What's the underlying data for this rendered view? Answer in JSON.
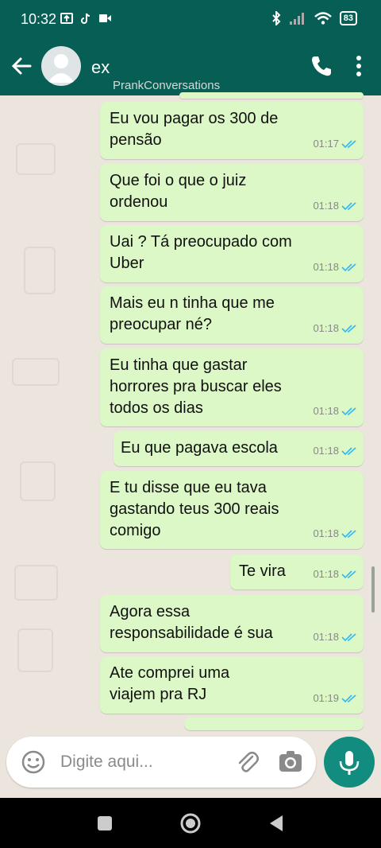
{
  "status_bar": {
    "time": "10:32",
    "battery": "83"
  },
  "header": {
    "contact_name": "ex",
    "watermark": "PrankConversations"
  },
  "messages": [
    {
      "text": "Eu vou pagar os 300 de pensão",
      "time": "01:17"
    },
    {
      "text": "Que foi o que o juiz ordenou",
      "time": "01:18"
    },
    {
      "text": "Uai ? Tá preocupado com Uber",
      "time": "01:18"
    },
    {
      "text": "Mais eu n tinha que me preocupar né?",
      "time": "01:18"
    },
    {
      "text": "Eu tinha que gastar horrores pra buscar eles todos os dias",
      "time": "01:18"
    },
    {
      "text": "Eu que pagava escola",
      "time": "01:18"
    },
    {
      "text": "E tu disse que eu tava gastando teus 300 reais comigo",
      "time": "01:18"
    },
    {
      "text": "Te vira",
      "time": "01:18"
    },
    {
      "text": "Agora essa responsabilidade é sua",
      "time": "01:18"
    },
    {
      "text": "Ate comprei uma viajem pra RJ",
      "time": "01:19"
    }
  ],
  "composer": {
    "placeholder": "Digite aqui..."
  },
  "colors": {
    "header": "#075e54",
    "bubble": "#dcf8c6",
    "tick": "#34b7f1",
    "fab": "#128c7e"
  }
}
